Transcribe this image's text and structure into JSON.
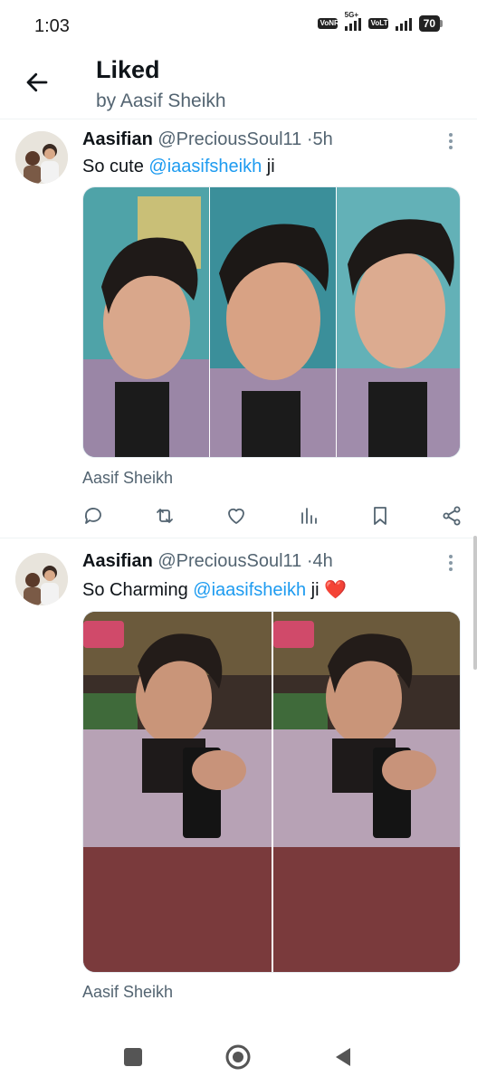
{
  "status_bar": {
    "time": "1:03",
    "signal_left": "VoNR",
    "network": "5G+",
    "signal_right": "VoLTE",
    "battery": "70"
  },
  "header": {
    "title": "Liked",
    "subtitle": "by Aasif Sheikh"
  },
  "tweets": [
    {
      "name": "Aasifian",
      "handle": "@PreciousSoul11",
      "separator": "·",
      "time": "5h",
      "text_before": "So cute ",
      "mention": "@iaasifsheikh",
      "text_after": " ji",
      "emoji": "",
      "attribution": "Aasif Sheikh"
    },
    {
      "name": "Aasifian",
      "handle": "@PreciousSoul11",
      "separator": "·",
      "time": "4h",
      "text_before": "So Charming ",
      "mention": "@iaasifsheikh",
      "text_after": " ji ",
      "emoji": "❤️",
      "attribution": "Aasif Sheikh"
    }
  ],
  "icons": {
    "back": "arrow-left-icon",
    "more": "more-vertical-icon",
    "reply": "reply-icon",
    "retweet": "retweet-icon",
    "like": "heart-icon",
    "views": "views-icon",
    "bookmark": "bookmark-icon",
    "share": "share-icon"
  },
  "colors": {
    "accent": "#1d9bf0",
    "secondary_text": "#536471"
  }
}
